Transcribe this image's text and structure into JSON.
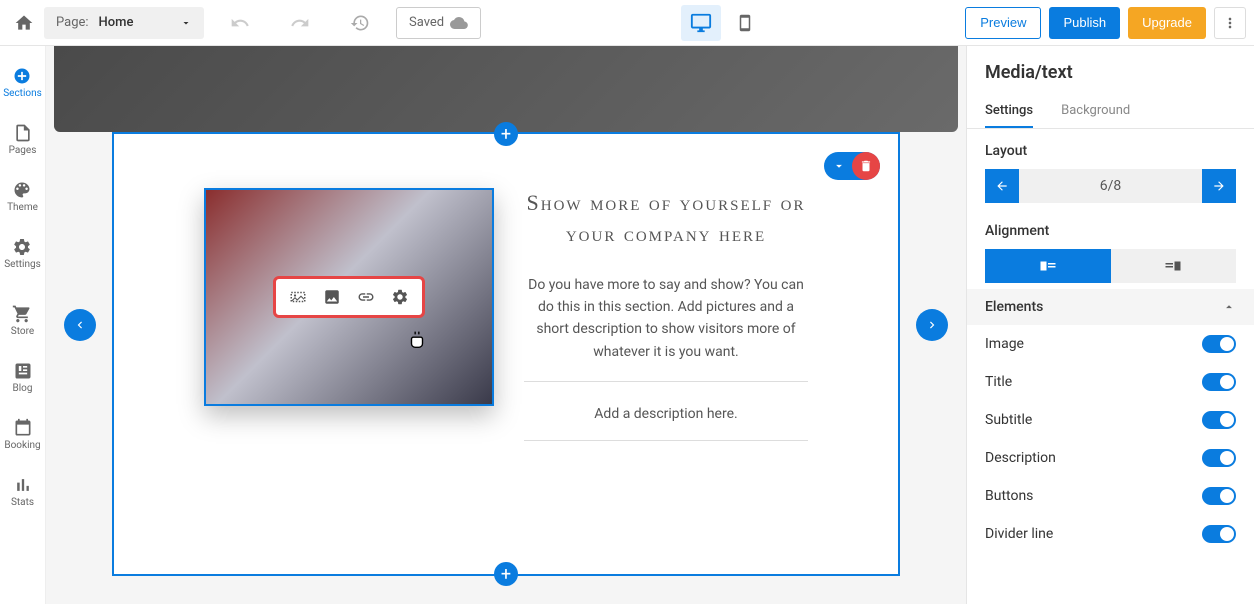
{
  "toolbar": {
    "page_label": "Page:",
    "page_value": "Home",
    "saved_label": "Saved",
    "preview": "Preview",
    "publish": "Publish",
    "upgrade": "Upgrade"
  },
  "sidebar": {
    "items": [
      {
        "label": "Sections"
      },
      {
        "label": "Pages"
      },
      {
        "label": "Theme"
      },
      {
        "label": "Settings"
      },
      {
        "label": "Store"
      },
      {
        "label": "Blog"
      },
      {
        "label": "Booking"
      },
      {
        "label": "Stats"
      }
    ]
  },
  "content": {
    "title": "Show more of yourself or your company here",
    "description": "Do you have more to say and show? You can do this in this section. Add pictures and a short description to show visitors more of whatever it is you want.",
    "subdesc": "Add a description here."
  },
  "panel": {
    "title": "Media/text",
    "tabs": {
      "settings": "Settings",
      "background": "Background"
    },
    "layout_label": "Layout",
    "layout_value": "6/8",
    "alignment_label": "Alignment",
    "elements_label": "Elements",
    "elements": [
      {
        "label": "Image"
      },
      {
        "label": "Title"
      },
      {
        "label": "Subtitle"
      },
      {
        "label": "Description"
      },
      {
        "label": "Buttons"
      },
      {
        "label": "Divider line"
      }
    ]
  }
}
